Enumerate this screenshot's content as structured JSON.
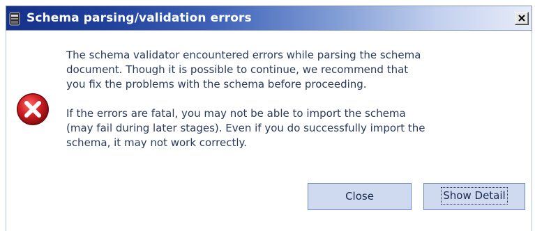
{
  "window": {
    "title": "Schema parsing/validation errors",
    "close_glyph": "X"
  },
  "icons": {
    "app": "application-icon",
    "error": "error-icon"
  },
  "message": {
    "paragraph1": "The schema validator encountered errors while parsing the schema\ndocument. Though it is possible to continue, we recommend that\nyou fix the problems with the schema before proceeding.",
    "paragraph2": "If the errors are fatal, you may not be able to import the schema\n(may fail during later stages). Even if you do successfully import the\nschema, it may not work correctly."
  },
  "buttons": {
    "close_label": "Close",
    "show_detail_label": "Show Detail"
  },
  "colors": {
    "titlebar_start": "#16318a",
    "titlebar_end": "#e7ecf8",
    "title_text": "#ffffff",
    "message_text": "#2a3a5c",
    "button_bg": "#cfdaf0",
    "button_border": "#6e89bf",
    "error_red": "#d21f24"
  }
}
